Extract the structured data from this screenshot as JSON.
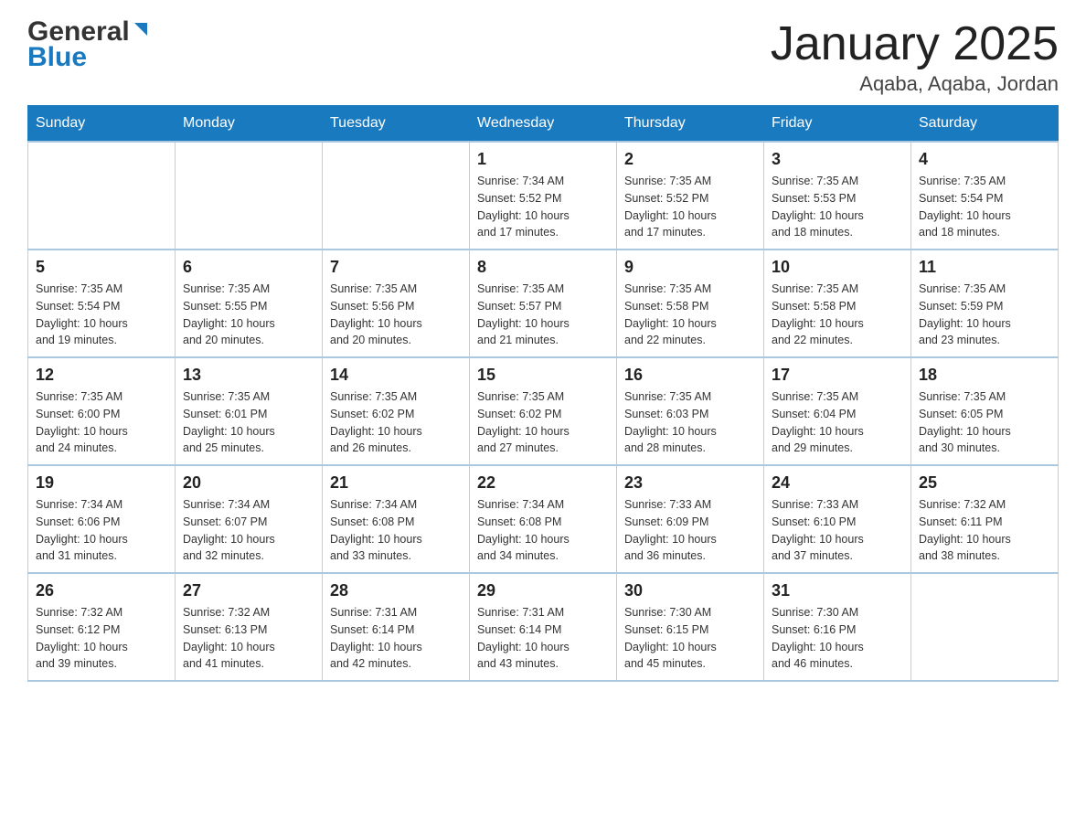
{
  "logo": {
    "general": "General",
    "blue": "Blue"
  },
  "title": "January 2025",
  "location": "Aqaba, Aqaba, Jordan",
  "days_of_week": [
    "Sunday",
    "Monday",
    "Tuesday",
    "Wednesday",
    "Thursday",
    "Friday",
    "Saturday"
  ],
  "weeks": [
    [
      {
        "day": "",
        "info": ""
      },
      {
        "day": "",
        "info": ""
      },
      {
        "day": "",
        "info": ""
      },
      {
        "day": "1",
        "info": "Sunrise: 7:34 AM\nSunset: 5:52 PM\nDaylight: 10 hours\nand 17 minutes."
      },
      {
        "day": "2",
        "info": "Sunrise: 7:35 AM\nSunset: 5:52 PM\nDaylight: 10 hours\nand 17 minutes."
      },
      {
        "day": "3",
        "info": "Sunrise: 7:35 AM\nSunset: 5:53 PM\nDaylight: 10 hours\nand 18 minutes."
      },
      {
        "day": "4",
        "info": "Sunrise: 7:35 AM\nSunset: 5:54 PM\nDaylight: 10 hours\nand 18 minutes."
      }
    ],
    [
      {
        "day": "5",
        "info": "Sunrise: 7:35 AM\nSunset: 5:54 PM\nDaylight: 10 hours\nand 19 minutes."
      },
      {
        "day": "6",
        "info": "Sunrise: 7:35 AM\nSunset: 5:55 PM\nDaylight: 10 hours\nand 20 minutes."
      },
      {
        "day": "7",
        "info": "Sunrise: 7:35 AM\nSunset: 5:56 PM\nDaylight: 10 hours\nand 20 minutes."
      },
      {
        "day": "8",
        "info": "Sunrise: 7:35 AM\nSunset: 5:57 PM\nDaylight: 10 hours\nand 21 minutes."
      },
      {
        "day": "9",
        "info": "Sunrise: 7:35 AM\nSunset: 5:58 PM\nDaylight: 10 hours\nand 22 minutes."
      },
      {
        "day": "10",
        "info": "Sunrise: 7:35 AM\nSunset: 5:58 PM\nDaylight: 10 hours\nand 22 minutes."
      },
      {
        "day": "11",
        "info": "Sunrise: 7:35 AM\nSunset: 5:59 PM\nDaylight: 10 hours\nand 23 minutes."
      }
    ],
    [
      {
        "day": "12",
        "info": "Sunrise: 7:35 AM\nSunset: 6:00 PM\nDaylight: 10 hours\nand 24 minutes."
      },
      {
        "day": "13",
        "info": "Sunrise: 7:35 AM\nSunset: 6:01 PM\nDaylight: 10 hours\nand 25 minutes."
      },
      {
        "day": "14",
        "info": "Sunrise: 7:35 AM\nSunset: 6:02 PM\nDaylight: 10 hours\nand 26 minutes."
      },
      {
        "day": "15",
        "info": "Sunrise: 7:35 AM\nSunset: 6:02 PM\nDaylight: 10 hours\nand 27 minutes."
      },
      {
        "day": "16",
        "info": "Sunrise: 7:35 AM\nSunset: 6:03 PM\nDaylight: 10 hours\nand 28 minutes."
      },
      {
        "day": "17",
        "info": "Sunrise: 7:35 AM\nSunset: 6:04 PM\nDaylight: 10 hours\nand 29 minutes."
      },
      {
        "day": "18",
        "info": "Sunrise: 7:35 AM\nSunset: 6:05 PM\nDaylight: 10 hours\nand 30 minutes."
      }
    ],
    [
      {
        "day": "19",
        "info": "Sunrise: 7:34 AM\nSunset: 6:06 PM\nDaylight: 10 hours\nand 31 minutes."
      },
      {
        "day": "20",
        "info": "Sunrise: 7:34 AM\nSunset: 6:07 PM\nDaylight: 10 hours\nand 32 minutes."
      },
      {
        "day": "21",
        "info": "Sunrise: 7:34 AM\nSunset: 6:08 PM\nDaylight: 10 hours\nand 33 minutes."
      },
      {
        "day": "22",
        "info": "Sunrise: 7:34 AM\nSunset: 6:08 PM\nDaylight: 10 hours\nand 34 minutes."
      },
      {
        "day": "23",
        "info": "Sunrise: 7:33 AM\nSunset: 6:09 PM\nDaylight: 10 hours\nand 36 minutes."
      },
      {
        "day": "24",
        "info": "Sunrise: 7:33 AM\nSunset: 6:10 PM\nDaylight: 10 hours\nand 37 minutes."
      },
      {
        "day": "25",
        "info": "Sunrise: 7:32 AM\nSunset: 6:11 PM\nDaylight: 10 hours\nand 38 minutes."
      }
    ],
    [
      {
        "day": "26",
        "info": "Sunrise: 7:32 AM\nSunset: 6:12 PM\nDaylight: 10 hours\nand 39 minutes."
      },
      {
        "day": "27",
        "info": "Sunrise: 7:32 AM\nSunset: 6:13 PM\nDaylight: 10 hours\nand 41 minutes."
      },
      {
        "day": "28",
        "info": "Sunrise: 7:31 AM\nSunset: 6:14 PM\nDaylight: 10 hours\nand 42 minutes."
      },
      {
        "day": "29",
        "info": "Sunrise: 7:31 AM\nSunset: 6:14 PM\nDaylight: 10 hours\nand 43 minutes."
      },
      {
        "day": "30",
        "info": "Sunrise: 7:30 AM\nSunset: 6:15 PM\nDaylight: 10 hours\nand 45 minutes."
      },
      {
        "day": "31",
        "info": "Sunrise: 7:30 AM\nSunset: 6:16 PM\nDaylight: 10 hours\nand 46 minutes."
      },
      {
        "day": "",
        "info": ""
      }
    ]
  ]
}
